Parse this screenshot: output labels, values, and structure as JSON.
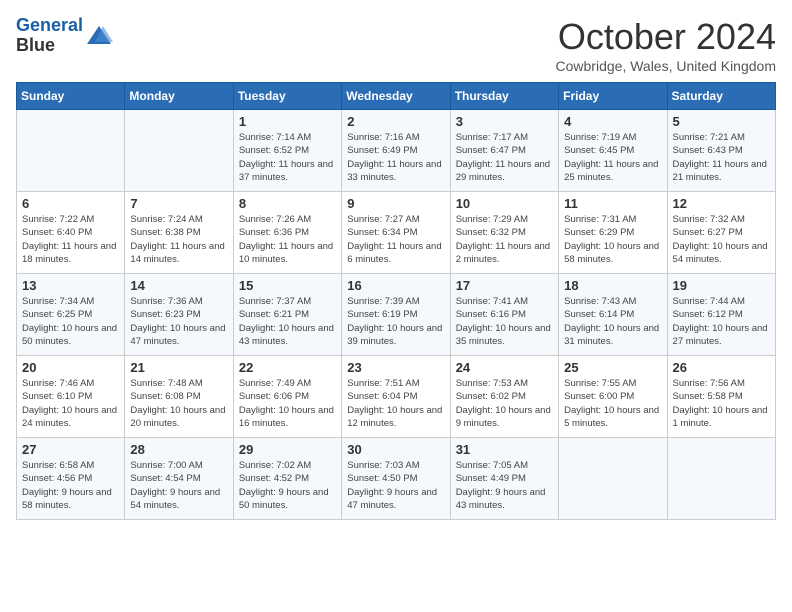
{
  "header": {
    "logo_line1": "General",
    "logo_line2": "Blue",
    "title": "October 2024",
    "location": "Cowbridge, Wales, United Kingdom"
  },
  "days_of_week": [
    "Sunday",
    "Monday",
    "Tuesday",
    "Wednesday",
    "Thursday",
    "Friday",
    "Saturday"
  ],
  "weeks": [
    [
      {
        "day": "",
        "info": ""
      },
      {
        "day": "",
        "info": ""
      },
      {
        "day": "1",
        "info": "Sunrise: 7:14 AM\nSunset: 6:52 PM\nDaylight: 11 hours and 37 minutes."
      },
      {
        "day": "2",
        "info": "Sunrise: 7:16 AM\nSunset: 6:49 PM\nDaylight: 11 hours and 33 minutes."
      },
      {
        "day": "3",
        "info": "Sunrise: 7:17 AM\nSunset: 6:47 PM\nDaylight: 11 hours and 29 minutes."
      },
      {
        "day": "4",
        "info": "Sunrise: 7:19 AM\nSunset: 6:45 PM\nDaylight: 11 hours and 25 minutes."
      },
      {
        "day": "5",
        "info": "Sunrise: 7:21 AM\nSunset: 6:43 PM\nDaylight: 11 hours and 21 minutes."
      }
    ],
    [
      {
        "day": "6",
        "info": "Sunrise: 7:22 AM\nSunset: 6:40 PM\nDaylight: 11 hours and 18 minutes."
      },
      {
        "day": "7",
        "info": "Sunrise: 7:24 AM\nSunset: 6:38 PM\nDaylight: 11 hours and 14 minutes."
      },
      {
        "day": "8",
        "info": "Sunrise: 7:26 AM\nSunset: 6:36 PM\nDaylight: 11 hours and 10 minutes."
      },
      {
        "day": "9",
        "info": "Sunrise: 7:27 AM\nSunset: 6:34 PM\nDaylight: 11 hours and 6 minutes."
      },
      {
        "day": "10",
        "info": "Sunrise: 7:29 AM\nSunset: 6:32 PM\nDaylight: 11 hours and 2 minutes."
      },
      {
        "day": "11",
        "info": "Sunrise: 7:31 AM\nSunset: 6:29 PM\nDaylight: 10 hours and 58 minutes."
      },
      {
        "day": "12",
        "info": "Sunrise: 7:32 AM\nSunset: 6:27 PM\nDaylight: 10 hours and 54 minutes."
      }
    ],
    [
      {
        "day": "13",
        "info": "Sunrise: 7:34 AM\nSunset: 6:25 PM\nDaylight: 10 hours and 50 minutes."
      },
      {
        "day": "14",
        "info": "Sunrise: 7:36 AM\nSunset: 6:23 PM\nDaylight: 10 hours and 47 minutes."
      },
      {
        "day": "15",
        "info": "Sunrise: 7:37 AM\nSunset: 6:21 PM\nDaylight: 10 hours and 43 minutes."
      },
      {
        "day": "16",
        "info": "Sunrise: 7:39 AM\nSunset: 6:19 PM\nDaylight: 10 hours and 39 minutes."
      },
      {
        "day": "17",
        "info": "Sunrise: 7:41 AM\nSunset: 6:16 PM\nDaylight: 10 hours and 35 minutes."
      },
      {
        "day": "18",
        "info": "Sunrise: 7:43 AM\nSunset: 6:14 PM\nDaylight: 10 hours and 31 minutes."
      },
      {
        "day": "19",
        "info": "Sunrise: 7:44 AM\nSunset: 6:12 PM\nDaylight: 10 hours and 27 minutes."
      }
    ],
    [
      {
        "day": "20",
        "info": "Sunrise: 7:46 AM\nSunset: 6:10 PM\nDaylight: 10 hours and 24 minutes."
      },
      {
        "day": "21",
        "info": "Sunrise: 7:48 AM\nSunset: 6:08 PM\nDaylight: 10 hours and 20 minutes."
      },
      {
        "day": "22",
        "info": "Sunrise: 7:49 AM\nSunset: 6:06 PM\nDaylight: 10 hours and 16 minutes."
      },
      {
        "day": "23",
        "info": "Sunrise: 7:51 AM\nSunset: 6:04 PM\nDaylight: 10 hours and 12 minutes."
      },
      {
        "day": "24",
        "info": "Sunrise: 7:53 AM\nSunset: 6:02 PM\nDaylight: 10 hours and 9 minutes."
      },
      {
        "day": "25",
        "info": "Sunrise: 7:55 AM\nSunset: 6:00 PM\nDaylight: 10 hours and 5 minutes."
      },
      {
        "day": "26",
        "info": "Sunrise: 7:56 AM\nSunset: 5:58 PM\nDaylight: 10 hours and 1 minute."
      }
    ],
    [
      {
        "day": "27",
        "info": "Sunrise: 6:58 AM\nSunset: 4:56 PM\nDaylight: 9 hours and 58 minutes."
      },
      {
        "day": "28",
        "info": "Sunrise: 7:00 AM\nSunset: 4:54 PM\nDaylight: 9 hours and 54 minutes."
      },
      {
        "day": "29",
        "info": "Sunrise: 7:02 AM\nSunset: 4:52 PM\nDaylight: 9 hours and 50 minutes."
      },
      {
        "day": "30",
        "info": "Sunrise: 7:03 AM\nSunset: 4:50 PM\nDaylight: 9 hours and 47 minutes."
      },
      {
        "day": "31",
        "info": "Sunrise: 7:05 AM\nSunset: 4:49 PM\nDaylight: 9 hours and 43 minutes."
      },
      {
        "day": "",
        "info": ""
      },
      {
        "day": "",
        "info": ""
      }
    ]
  ]
}
